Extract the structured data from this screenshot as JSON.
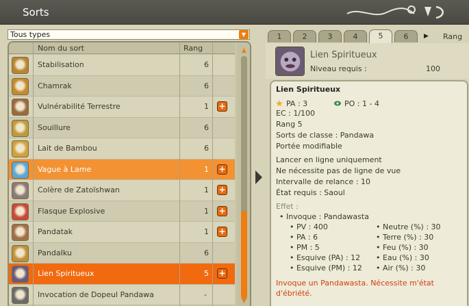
{
  "window": {
    "title": "Sorts"
  },
  "filter": {
    "selected": "Tous types"
  },
  "list": {
    "header_name": "Nom du sort",
    "header_rang": "Rang",
    "rows": [
      {
        "name": "Stabilisation",
        "rang": "6",
        "plus": "",
        "state": "odd",
        "color": "#b8862e"
      },
      {
        "name": "Chamrak",
        "rang": "6",
        "plus": "",
        "state": "even",
        "color": "#c48a2e"
      },
      {
        "name": "Vulnérabilité Terrestre",
        "rang": "1",
        "plus": "+",
        "state": "odd",
        "color": "#9a6a3e"
      },
      {
        "name": "Souillure",
        "rang": "6",
        "plus": "",
        "state": "even",
        "color": "#c09a3a"
      },
      {
        "name": "Lait de Bambou",
        "rang": "6",
        "plus": "",
        "state": "odd",
        "color": "#d0a23a"
      },
      {
        "name": "Vague à Lame",
        "rang": "1",
        "plus": "+",
        "state": "hl",
        "color": "#5aa8d8"
      },
      {
        "name": "Colère de Zatoïshwan",
        "rang": "1",
        "plus": "+",
        "state": "odd",
        "color": "#8a7a7a"
      },
      {
        "name": "Flasque Explosive",
        "rang": "1",
        "plus": "+",
        "state": "even",
        "color": "#c84a3a"
      },
      {
        "name": "Pandatak",
        "rang": "1",
        "plus": "+",
        "state": "odd",
        "color": "#a0704a"
      },
      {
        "name": "PandaIku",
        "rang": "6",
        "plus": "",
        "state": "even",
        "color": "#c0903a"
      },
      {
        "name": "Lien Spiritueux",
        "rang": "5",
        "plus": "+",
        "state": "sel",
        "color": "#6a5a7a"
      },
      {
        "name": "Invocation de Dopeul Pandawa",
        "rang": "-",
        "plus": "",
        "state": "odd",
        "color": "#6a6a6a"
      }
    ]
  },
  "tabs": {
    "items": [
      "1",
      "2",
      "3",
      "4",
      "5",
      "6"
    ],
    "active": "5",
    "rang_label": "Rang"
  },
  "spell": {
    "name": "Lien Spiritueux",
    "niveau_label": "Niveau requis :",
    "niveau_value": "100",
    "detail_title": "Lien Spiritueux",
    "pa": "PA : 3",
    "po": "PO : 1 - 4",
    "lines": [
      "EC : 1/100",
      "Rang 5",
      "Sorts de classe : Pandawa",
      "Portée modifiable"
    ],
    "lines2": [
      "Lancer en ligne uniquement",
      "Ne nécessite pas de ligne de vue",
      "Intervalle de relance : 10",
      "État requis : Saoul"
    ],
    "effet_label": "Effet :",
    "invoque": "• Invoque : Pandawasta",
    "stats_left": [
      "• PV : 400",
      "• PA : 6",
      "• PM : 5",
      "• Esquive (PA) : 12",
      "• Esquive (PM) : 12"
    ],
    "stats_right": [
      "• Neutre (%) : 30",
      "• Terre (%) : 30",
      "• Feu (%) : 30",
      "• Eau (%) : 30",
      "• Air (%) : 30"
    ],
    "note": "Invoque un Pandawasta. Nécessite m'état d'ébriété."
  }
}
